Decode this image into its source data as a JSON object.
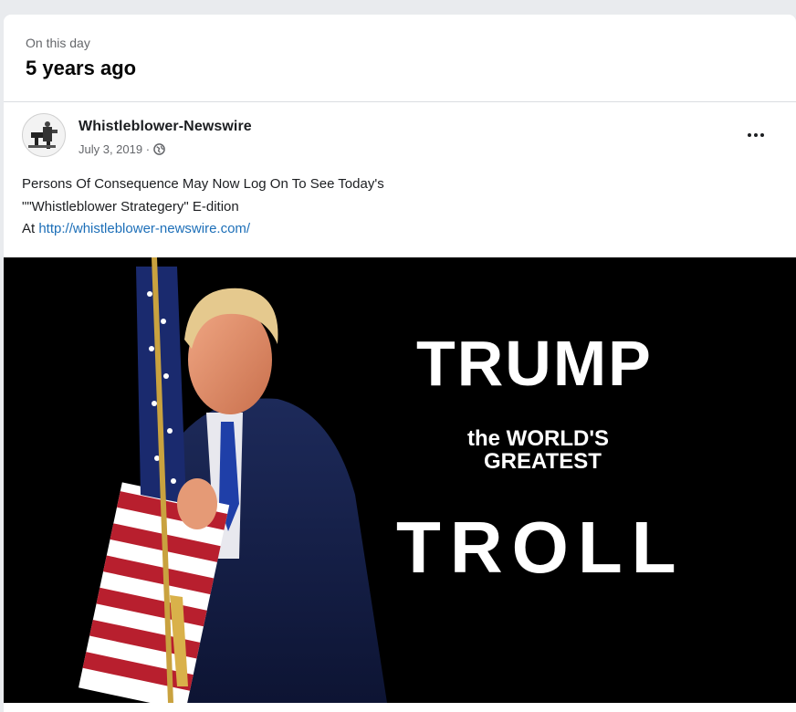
{
  "memory": {
    "label": "On this day",
    "title": "5 years ago"
  },
  "post": {
    "page_name": "Whistleblower-Newswire",
    "date": "July 3, 2019 ·",
    "text_line1": "Persons Of Consequence May Now Log On To See Today's",
    "text_line2": "\"\"Whistleblower Strategery\" E-dition",
    "text_line3_prefix": "At ",
    "link": "http://whistleblower-newswire.com/"
  },
  "image": {
    "line1": "TRUMP",
    "line2": "the WORLD'S",
    "line3": "GREATEST",
    "line4": "TROLL"
  },
  "icons": {
    "privacy": "globe-icon",
    "menu": "more-options-icon"
  },
  "colors": {
    "link": "#1d6fb8",
    "secondary_text": "#65676b",
    "image_background": "#000000"
  }
}
